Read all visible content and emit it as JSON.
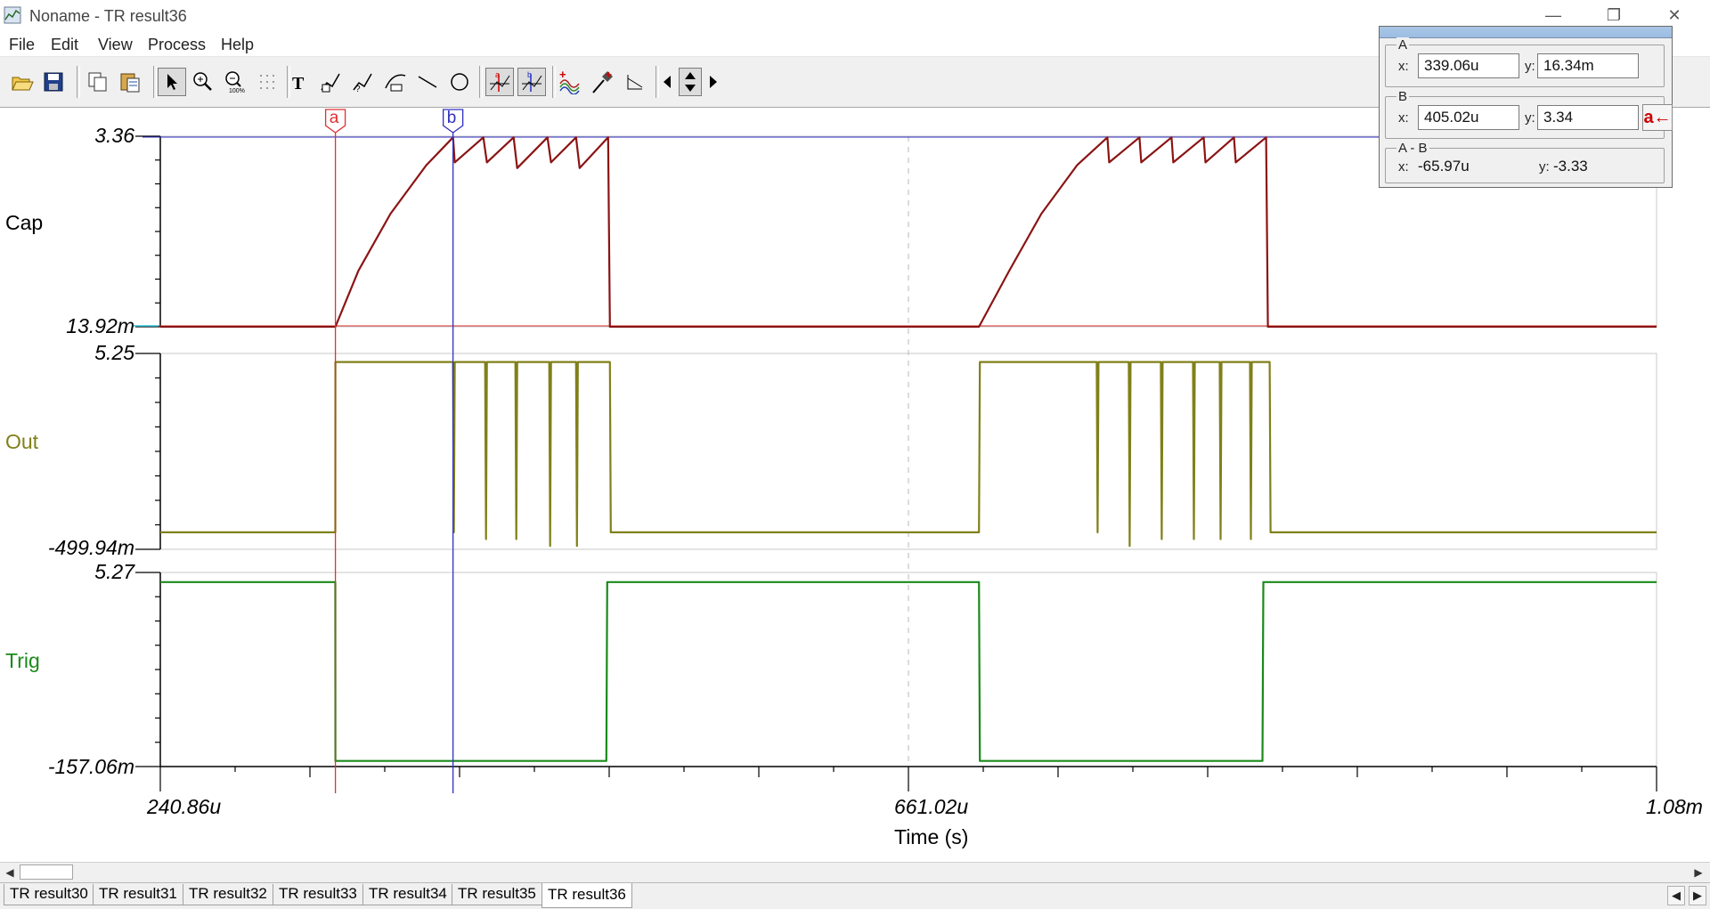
{
  "window": {
    "title": "Noname - TR result36",
    "minimize": "—",
    "restore": "❐",
    "close": "✕"
  },
  "menu": [
    "File",
    "Edit",
    "View",
    "Process",
    "Help"
  ],
  "toolbar": {
    "buttons": [
      "open-icon",
      "save-icon",
      "copy-icon",
      "paste-icon",
      "pointer-icon",
      "zoom-in-icon",
      "zoom-out-icon",
      "grid-icon",
      "text-icon",
      "annotate-icon",
      "annotate-2-icon",
      "annotate-3-icon",
      "line-icon",
      "circle-icon",
      "cursor-a-icon",
      "cursor-b-icon",
      "add-curve-icon",
      "marker-icon",
      "slope-icon",
      "nav-left-icon",
      "nav-updown-icon",
      "nav-right-icon"
    ]
  },
  "colors": {
    "cap": "#8b1414",
    "out": "#80801a",
    "trig": "#1a8a1a",
    "cursor_a": "#e03030",
    "cursor_b": "#3030c0",
    "axis": "#000000"
  },
  "chart_data": {
    "type": "line",
    "x_unit": "s",
    "xlabel": "Time (s)",
    "xlim": [
      0.00024086,
      0.00108
    ],
    "x_tick_labels": [
      "240.86u",
      "661.02u",
      "1.08m"
    ],
    "series": [
      {
        "name": "Cap",
        "ylim": [
          0.01392,
          3.36
        ],
        "y_tick_labels": [
          "3.36",
          "13.92m"
        ],
        "points": [
          [
            0.00024086,
            0.0139
          ],
          [
            0.00033906,
            0.0139
          ],
          [
            0.000352,
            1.0
          ],
          [
            0.00037,
            2.0
          ],
          [
            0.00039,
            2.85
          ],
          [
            0.00040502,
            3.34
          ],
          [
            0.000406,
            2.9
          ],
          [
            0.000422,
            3.34
          ],
          [
            0.000424,
            2.9
          ],
          [
            0.000439,
            3.34
          ],
          [
            0.000441,
            2.8
          ],
          [
            0.000458,
            3.34
          ],
          [
            0.00046,
            2.9
          ],
          [
            0.000474,
            3.34
          ],
          [
            0.000476,
            2.8
          ],
          [
            0.000492,
            3.34
          ],
          [
            0.000493,
            0.0139
          ],
          [
            0.0007,
            0.0139
          ],
          [
            0.000717,
            1.0
          ],
          [
            0.000735,
            2.0
          ],
          [
            0.000755,
            2.85
          ],
          [
            0.000772,
            3.34
          ],
          [
            0.000773,
            2.9
          ],
          [
            0.00079,
            3.34
          ],
          [
            0.000791,
            2.9
          ],
          [
            0.000808,
            3.34
          ],
          [
            0.000809,
            2.9
          ],
          [
            0.000826,
            3.34
          ],
          [
            0.000827,
            2.9
          ],
          [
            0.000843,
            3.34
          ],
          [
            0.000844,
            2.9
          ],
          [
            0.000861,
            3.34
          ],
          [
            0.000862,
            0.0139
          ],
          [
            0.00108,
            0.0139
          ]
        ]
      },
      {
        "name": "Out",
        "ylim": [
          -0.49994,
          5.25
        ],
        "y_tick_labels": [
          "5.25",
          "-499.94m"
        ],
        "points": [
          [
            0.00024086,
            0.0
          ],
          [
            0.000339,
            0.0
          ],
          [
            0.00033906,
            5.0
          ],
          [
            0.000405,
            5.0
          ],
          [
            0.0004055,
            0.0
          ],
          [
            0.000406,
            5.0
          ],
          [
            0.000423,
            5.0
          ],
          [
            0.0004235,
            -0.2
          ],
          [
            0.000424,
            5.0
          ],
          [
            0.00044,
            5.0
          ],
          [
            0.0004405,
            -0.2
          ],
          [
            0.000441,
            5.0
          ],
          [
            0.000459,
            5.0
          ],
          [
            0.0004595,
            -0.4
          ],
          [
            0.00046,
            5.0
          ],
          [
            0.000474,
            5.0
          ],
          [
            0.0004745,
            -0.4
          ],
          [
            0.000475,
            5.0
          ],
          [
            0.000493,
            5.0
          ],
          [
            0.0004935,
            0.0
          ],
          [
            0.0007,
            0.0
          ],
          [
            0.0007005,
            5.0
          ],
          [
            0.000766,
            5.0
          ],
          [
            0.0007665,
            0.0
          ],
          [
            0.000767,
            5.0
          ],
          [
            0.000784,
            5.0
          ],
          [
            0.0007845,
            -0.4
          ],
          [
            0.000785,
            5.0
          ],
          [
            0.000802,
            5.0
          ],
          [
            0.0008025,
            -0.2
          ],
          [
            0.000803,
            5.0
          ],
          [
            0.00082,
            5.0
          ],
          [
            0.0008205,
            -0.2
          ],
          [
            0.000821,
            5.0
          ],
          [
            0.000835,
            5.0
          ],
          [
            0.0008355,
            -0.2
          ],
          [
            0.000836,
            5.0
          ],
          [
            0.000852,
            5.0
          ],
          [
            0.0008525,
            -0.2
          ],
          [
            0.000853,
            5.0
          ],
          [
            0.000863,
            5.0
          ],
          [
            0.0008635,
            0.0
          ],
          [
            0.00108,
            0.0
          ]
        ]
      },
      {
        "name": "Trig",
        "ylim": [
          -0.15706,
          5.27
        ],
        "y_tick_labels": [
          "5.27",
          "-157.06m"
        ],
        "points": [
          [
            0.00024086,
            5.0
          ],
          [
            0.000339,
            5.0
          ],
          [
            0.00033906,
            0.0
          ],
          [
            0.000491,
            0.0
          ],
          [
            0.0004915,
            5.0
          ],
          [
            0.0007,
            5.0
          ],
          [
            0.0007005,
            0.0
          ],
          [
            0.000859,
            0.0
          ],
          [
            0.0008595,
            5.0
          ],
          [
            0.00108,
            5.0
          ]
        ]
      }
    ],
    "cursors": [
      {
        "name": "a",
        "x": 0.00033906
      },
      {
        "name": "b",
        "x": 0.00040502
      }
    ],
    "grid": "center dashed vertical line"
  },
  "cursor_panel": {
    "a": {
      "label": "A",
      "x_label": "x:",
      "y_label": "y:",
      "x": "339.06u",
      "y": "16.34m"
    },
    "b": {
      "label": "B",
      "x_label": "x:",
      "y_label": "y:",
      "x": "405.02u",
      "y": "3.34",
      "button": "a←"
    },
    "diff": {
      "label": "A - B",
      "x_label": "x:",
      "y_label": "y:",
      "x": "-65.97u",
      "y": "-3.33"
    }
  },
  "tabs": [
    "TR result30",
    "TR result31",
    "TR result32",
    "TR result33",
    "TR result34",
    "TR result35",
    "TR result36"
  ],
  "active_tab": "TR result36"
}
